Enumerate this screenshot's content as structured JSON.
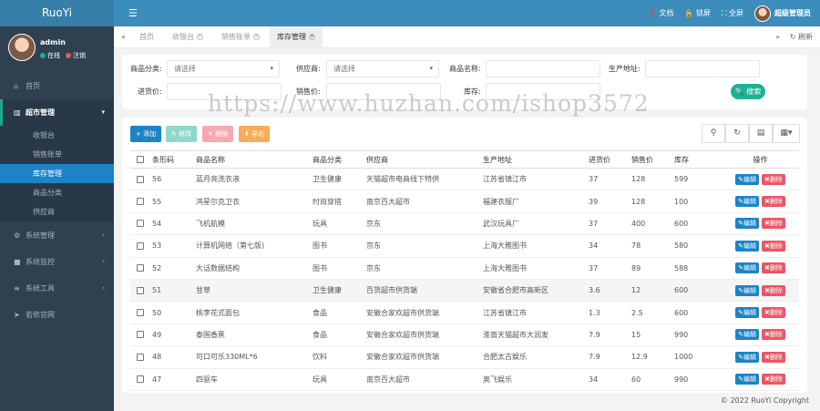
{
  "brand": "RuoYi",
  "user": {
    "name": "admin",
    "online": "在线",
    "logout": "注销"
  },
  "nav": {
    "home": "首页",
    "market": "超市管理",
    "market_items": [
      "收银台",
      "销售账单",
      "库存管理",
      "商品分类",
      "供应商"
    ],
    "system": "系统管理",
    "monitor": "系统监控",
    "tools": "系统工具",
    "site": "若依官网"
  },
  "topbar": {
    "docs": "文档",
    "lock": "锁屏",
    "fullscreen": "全屏",
    "admin": "超级管理员"
  },
  "tabs": {
    "home": "首页",
    "cashier": "收银台",
    "sales": "销售账单",
    "stock": "库存管理",
    "refresh": "刷新"
  },
  "search": {
    "category_label": "商品分类:",
    "category_value": "请选择",
    "supplier_label": "供应商:",
    "supplier_value": "请选择",
    "name_label": "商品名称:",
    "origin_label": "生产地址:",
    "buy_label": "进货价:",
    "sell_label": "销售价:",
    "stock_label": "库存:",
    "search_btn": "搜索"
  },
  "toolbar": {
    "add": "添加",
    "edit": "修改",
    "delete": "删除",
    "export": "导出"
  },
  "watermark": "https://www.huzhan.com/ishop3572",
  "table": {
    "headers": [
      "条形码",
      "商品名称",
      "商品分类",
      "供应商",
      "生产地址",
      "进货价",
      "销售价",
      "库存",
      "操作"
    ],
    "edit_label": "编辑",
    "delete_label": "删除",
    "rows": [
      [
        "56",
        "蓝月亮洗衣液",
        "卫生健康",
        "天猫超市电商线下特供",
        "江苏省镇江市",
        "37",
        "128",
        "599"
      ],
      [
        "55",
        "鸿星尔克卫衣",
        "时尚穿搭",
        "南京百大超市",
        "福建衣服厂",
        "39",
        "128",
        "100"
      ],
      [
        "54",
        "飞机航模",
        "玩具",
        "京东",
        "武汉玩具厂",
        "37",
        "400",
        "600"
      ],
      [
        "53",
        "计算机网络（第七版)",
        "图书",
        "京东",
        "上海大雅图书",
        "34",
        "78",
        "580"
      ],
      [
        "52",
        "大话数据结构",
        "图书",
        "京东",
        "上海大雅图书",
        "37",
        "89",
        "588"
      ],
      [
        "51",
        "甘草",
        "卫生健康",
        "百货超市供货端",
        "安徽省合肥市高新区",
        "3.6",
        "12",
        "600"
      ],
      [
        "50",
        "桃李花式面包",
        "食品",
        "安徽合家欢超市供货端",
        "江苏省镇江市",
        "1.3",
        "2.5",
        "600"
      ],
      [
        "49",
        "泰国香蕉",
        "食品",
        "安徽合家欢超市供货端",
        "淮南天猫超市大润发",
        "7.9",
        "15",
        "990"
      ],
      [
        "48",
        "可口可乐330ML*6",
        "饮料",
        "安徽合家欢超市供货端",
        "合肥太古娱乐",
        "7.9",
        "12.9",
        "1000"
      ],
      [
        "47",
        "四驱车",
        "玩具",
        "南京百大超市",
        "奥飞娱乐",
        "34",
        "60",
        "990"
      ]
    ]
  },
  "footer": "© 2022 RuoYi Copyright",
  "colors": {
    "sidebar": "#2f4050",
    "topbar": "#3c8dbc",
    "active": "#1c84c6",
    "add": "#1c84c6",
    "edit": "#1ab394",
    "delete": "#ed5565",
    "export": "#f8ac59"
  }
}
